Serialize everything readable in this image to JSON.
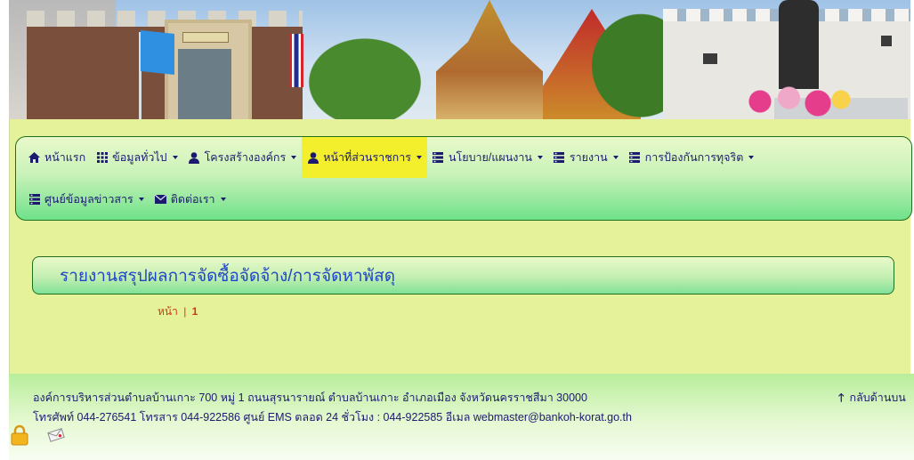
{
  "nav": {
    "row1": [
      {
        "icon": "home-icon",
        "label": "หน้าแรก",
        "has_dropdown": false
      },
      {
        "icon": "th-icon",
        "label": "ข้อมูลทั่วไป",
        "has_dropdown": true
      },
      {
        "icon": "user-icon",
        "label": "โครงสร้างองค์กร",
        "has_dropdown": true
      },
      {
        "icon": "user-icon",
        "label": "หน้าที่ส่วนราชการ",
        "has_dropdown": true,
        "active": true
      },
      {
        "icon": "tasks-icon",
        "label": "นโยบาย/แผนงาน",
        "has_dropdown": true
      },
      {
        "icon": "tasks-icon",
        "label": "รายงาน",
        "has_dropdown": true
      },
      {
        "icon": "tasks-icon",
        "label": "การป้องกันการทุจริต",
        "has_dropdown": true
      }
    ],
    "row2": [
      {
        "icon": "tasks-icon",
        "label": "ศูนย์ข้อมูลข่าวสาร",
        "has_dropdown": true
      },
      {
        "icon": "envelope-icon",
        "label": "ติดต่อเรา",
        "has_dropdown": true
      }
    ]
  },
  "page": {
    "title": "รายงานสรุปผลการจัดซื้อจัดจ้าง/การจัดหาพัสดุ"
  },
  "pager": {
    "label": "หน้า",
    "separator": "|",
    "current": "1"
  },
  "footer": {
    "address": "องค์การบริหารส่วนตำบลบ้านเกาะ 700 หมู่ 1 ถนนสุรนารายณ์ ตำบลบ้านเกาะ อำเภอเมือง จังหวัดนครราชสีมา 30000",
    "contact": "โทรศัพท์ 044-276541 โทรสาร 044-922586 ศูนย์ EMS ตลอด 24 ชั่วโมง : 044-922585 อีเมล webmaster@bankoh-korat.go.th",
    "back_to_top": "กลับด้านบน"
  },
  "colors": {
    "page_bg": "#e6f29a",
    "nav_text": "#1c1a6e",
    "nav_active_bg": "#f4ef2c",
    "title_text": "#1f46c7",
    "pager_text": "#d2361b",
    "border": "#1f6f1f"
  }
}
